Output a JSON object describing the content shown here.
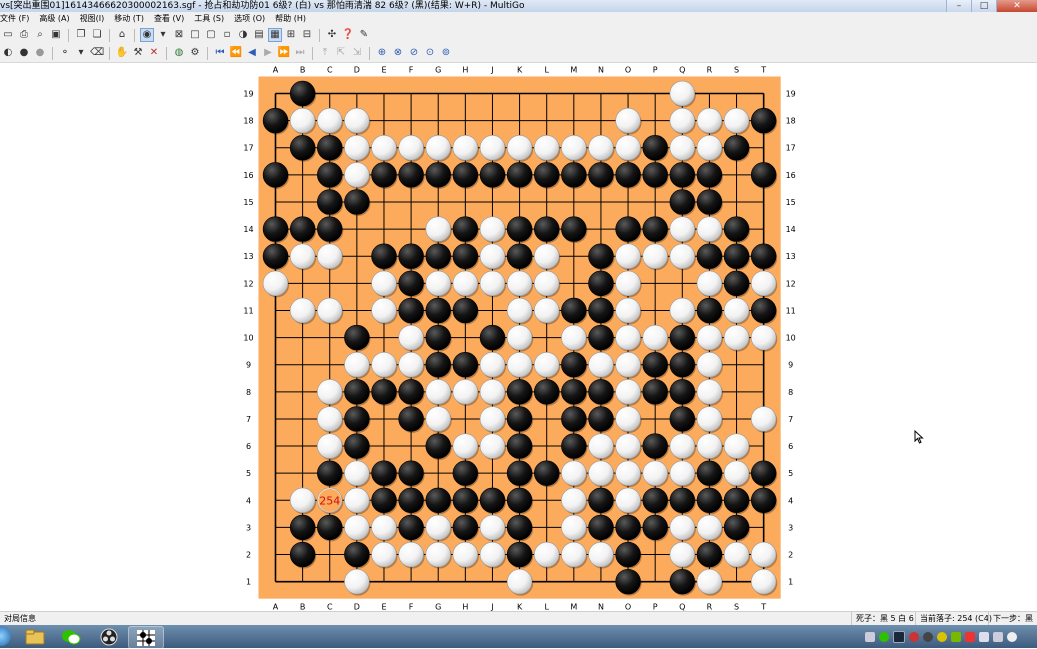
{
  "window": {
    "title": "vs[突出重围01]16143466620300002163.sgf - 抢占和劫功防01 6级? (白) vs 那怕雨清湍   82 6级? (黑)(结果: W+R) - MultiGo",
    "controls": [
      "–",
      "□",
      "✕"
    ]
  },
  "menu": [
    "文件 (F)",
    "高级 (A)",
    "视图(I)",
    "移动 (T)",
    "查看 (V)",
    "工具 (S)",
    "选项 (O)",
    "帮助 (H)"
  ],
  "toolbar1_icons": [
    "new-icon",
    "print-icon",
    "print-preview-icon",
    "save-icon",
    "copy-icon",
    "paste-icon",
    "open-board-icon",
    "stone-mode-icon",
    "dropdown-icon",
    "mark-x-icon",
    "mark-square-icon",
    "mark-square2-icon",
    "mark-empty-icon",
    "mark-circle-icon",
    "view1-icon",
    "view2-icon",
    "tree-icon",
    "tool1-icon",
    "tool2-icon",
    "tool3-icon"
  ],
  "toolbar2_icons": [
    "black-stone-icon",
    "black-dot-icon",
    "white-stone-icon",
    "stone-small-icon",
    "dropdown-icon",
    "erase-icon",
    "hand-icon",
    "tool-icon",
    "delete-icon",
    "globe-icon",
    "settings-icon",
    "first-move-icon",
    "back-many-icon",
    "back-icon",
    "forward-icon",
    "forward-many-icon",
    "last-move-icon",
    "prev-variation-icon",
    "up-variation-icon",
    "next-variation-icon",
    "zoom1-icon",
    "zoom2-icon",
    "zoom3-icon",
    "zoom4-icon",
    "zoom5-icon"
  ],
  "board": {
    "size": 19,
    "columns": [
      "A",
      "B",
      "C",
      "D",
      "E",
      "F",
      "G",
      "H",
      "J",
      "K",
      "L",
      "M",
      "N",
      "O",
      "P",
      "Q",
      "R",
      "S",
      "T"
    ],
    "rows": [
      "19",
      "18",
      "17",
      "16",
      "15",
      "14",
      "13",
      "12",
      "11",
      "10",
      "9",
      "8",
      "7",
      "6",
      "5",
      "4",
      "3",
      "2",
      "1"
    ],
    "rows_map": {
      "19": ".b.............w...",
      "18": "bwww.........w.wwwb",
      "17": ".bbwwwwwwwwwwwbwwb.",
      "16": "b.bwbbbbbbbbbbbbb.b",
      "15": "..bb...........bb..",
      "14": "bbb...wbwbbb.bbwwb.",
      "13": "bww.bbbbwbw.bwwwbbb",
      "12": "w...wbwwwww.bw..wbw",
      "11": ".ww.wbbb.wwbbw.wbwb",
      "10": "...b.wb.bw.wbwwbwww",
      "9": "...wwwbbwwwbwwbbw..",
      "8": "..wbbbwwwbbbbwbbw..",
      "7": "..wb.bw.wb.bbw.bw.w",
      "6": "..wb..bwwb.bwwbwww.",
      "5": "..bwbb.b.bbwwwwwbwb",
      "4": ".wwwbbbbbb.wbwbbbbb",
      "3": ".bbwwbwbwb.wbbbwwb.",
      "2": ".b.bwwwwwbwwwb.wbww",
      "1": "...w.....w...b.bw.w."
    },
    "last_move": {
      "col": "C",
      "row": "4",
      "label": "254"
    },
    "colors": {
      "board": "#fcaa5c",
      "line": "#000000",
      "label_color": "#cc1111"
    }
  },
  "status": {
    "left": "对局信息",
    "captures": "死子：黑 5 白 6",
    "current_move": "当前落子: 254 (C4)",
    "next": "下一步：黑"
  }
}
